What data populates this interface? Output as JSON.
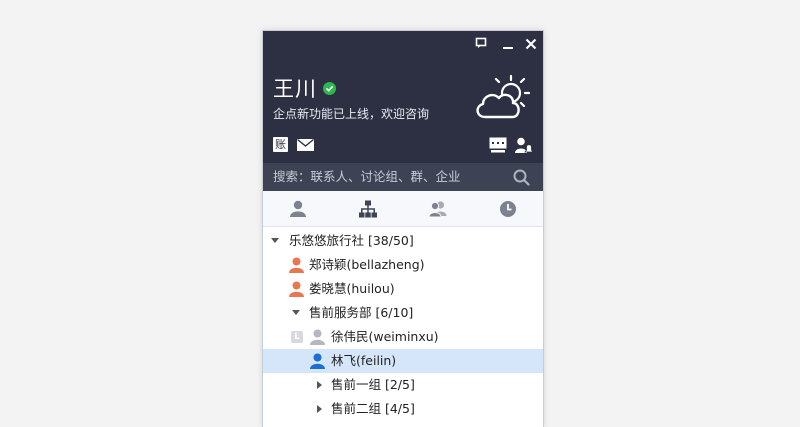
{
  "profile": {
    "name": "王川",
    "signature": "企点新功能已上线，欢迎咨询"
  },
  "toolbar": {
    "account_icon_label": "账"
  },
  "search": {
    "placeholder": "搜索：联系人、讨论组、群、企业"
  },
  "tabs": [
    {
      "icon": "person-icon",
      "active": false
    },
    {
      "icon": "org-chart-icon",
      "active": true
    },
    {
      "icon": "group-icon",
      "active": false
    },
    {
      "icon": "clock-icon",
      "active": false
    }
  ],
  "tree": {
    "org": {
      "label": "乐悠悠旅行社 [38/50]",
      "expanded": true
    },
    "members": [
      {
        "label": "郑诗颖(bellazheng)"
      },
      {
        "label": "娄晓慧(huilou)"
      }
    ],
    "dept": {
      "label": "售前服务部 [6/10]",
      "expanded": true
    },
    "dept_members": [
      {
        "label": "徐伟民(weiminxu)",
        "badge": "L"
      },
      {
        "label": "林飞(feilin)",
        "selected": true
      }
    ],
    "subgroups": [
      {
        "label": "售前一组 [2/5]"
      },
      {
        "label": "售前二组 [4/5]"
      }
    ]
  },
  "colors": {
    "header_bg": "#2c3042",
    "search_bg": "#3d4254",
    "selected_row": "#d5e6fb",
    "online_green": "#2db84d",
    "female_avatar": "#e8774f",
    "male_avatar_selected": "#1b6fd0",
    "offline_avatar": "#b4b8bf"
  }
}
